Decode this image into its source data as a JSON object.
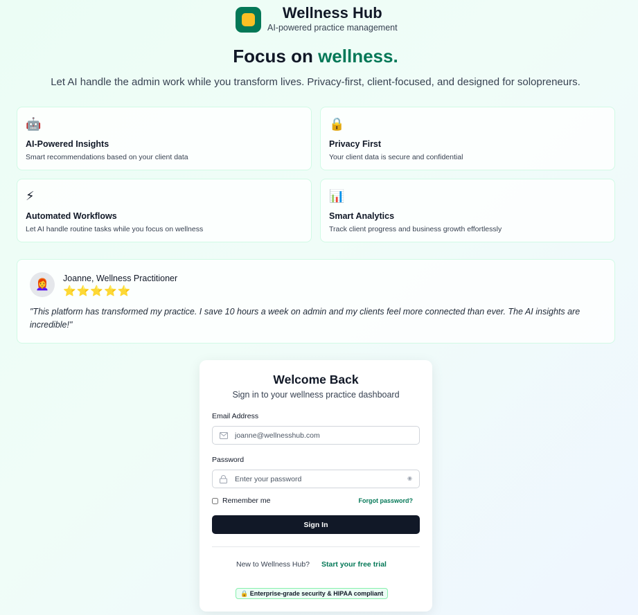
{
  "brand": {
    "title": "Wellness Hub",
    "subtitle": "AI-powered practice management",
    "logo_colors": {
      "background": "#047857",
      "inner": "#fbbf24"
    }
  },
  "hero": {
    "title_prefix": "Focus on ",
    "title_accent": "wellness.",
    "subtitle": "Let AI handle the admin work while you transform lives. Privacy-first, client-focused, and designed for solopreneurs."
  },
  "features": [
    {
      "icon": "🤖",
      "icon_name": "robot-icon",
      "title": "AI-Powered Insights",
      "description": "Smart recommendations based on your client data"
    },
    {
      "icon": "🔒",
      "icon_name": "lock-icon",
      "title": "Privacy First",
      "description": "Your client data is secure and confidential"
    },
    {
      "icon": "⚡",
      "icon_name": "lightning-icon",
      "title": "Automated Workflows",
      "description": "Let AI handle routine tasks while you focus on wellness"
    },
    {
      "icon": "📊",
      "icon_name": "bar-chart-icon",
      "title": "Smart Analytics",
      "description": "Track client progress and business growth effortlessly"
    }
  ],
  "testimonial": {
    "avatar": "👩‍🦰",
    "name": "Joanne, Wellness Practitioner",
    "stars": "⭐⭐⭐⭐⭐",
    "rating": 5,
    "quote": "\"This platform has transformed my practice. I save 10 hours a week on admin and my clients feel more connected than ever. The AI insights are incredible!\""
  },
  "login": {
    "title": "Welcome Back",
    "subtitle": "Sign in to your wellness practice dashboard",
    "email_label": "Email Address",
    "email_value": "joanne@wellnesshub.com",
    "password_label": "Password",
    "password_placeholder": "Enter your password",
    "remember_label": "Remember me",
    "forgot_label": "Forgot password?",
    "signin_label": "Sign In",
    "new_user_text": "New to Wellness Hub?",
    "trial_label": "Start your free trial",
    "security_badge": "🔒 Enterprise-grade security & HIPAA compliant"
  },
  "colors": {
    "accent": "#047857",
    "primary_button": "#111827"
  }
}
